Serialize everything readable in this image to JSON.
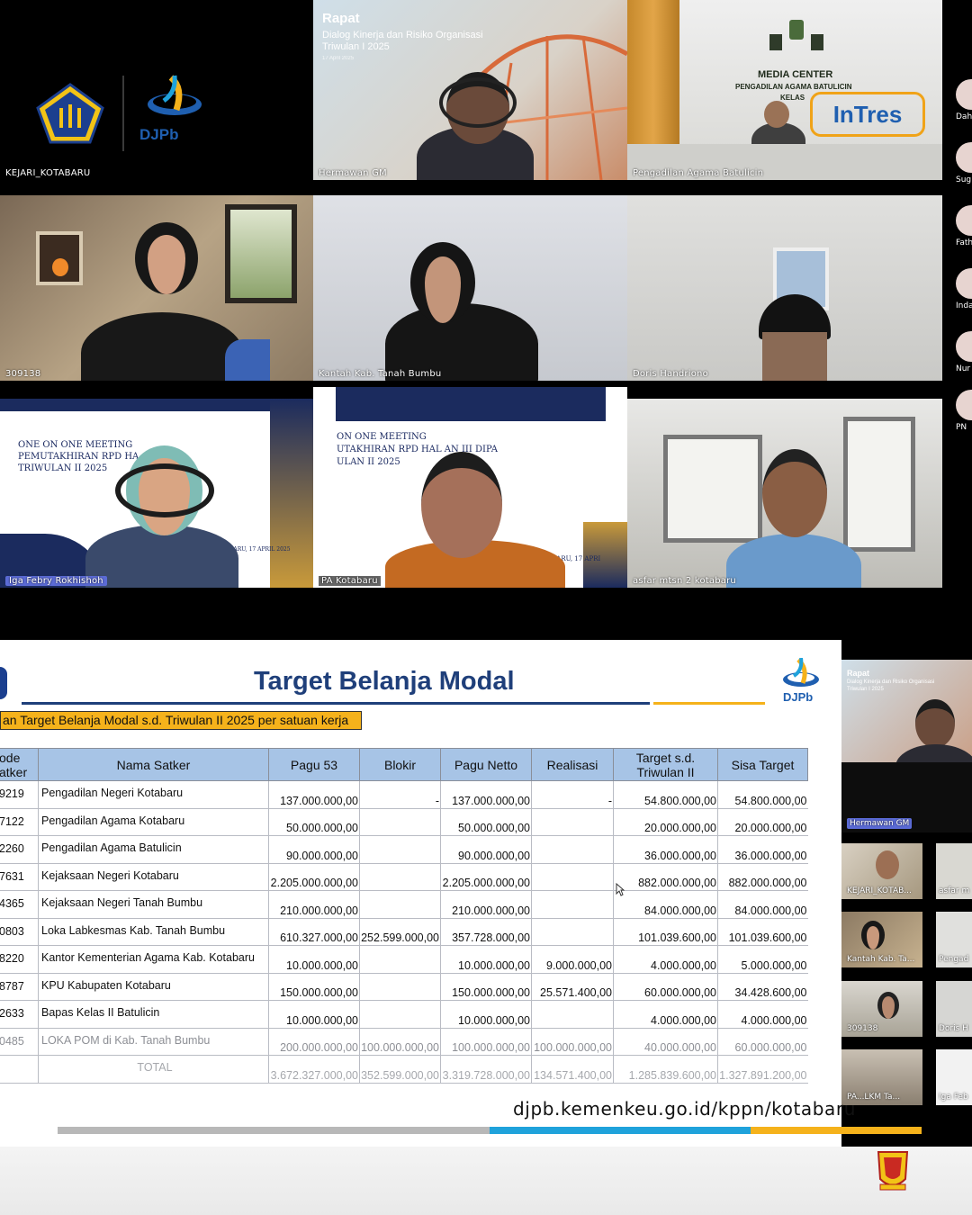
{
  "tiles": {
    "t1": "KEJARI_KOTABARU",
    "t2": "Hermawan GM",
    "t3": "Pengadilan Agama Batulicin",
    "t4": "309138",
    "t5": "Kantah Kab. Tanah Bumbu",
    "t6": "Doris Handriono",
    "t7": "Iga Febry Rokhishoh",
    "t8": "PA Kotabaru",
    "t9": "asfar mtsn 2 kotabaru"
  },
  "logo": {
    "djpb": "DJPb"
  },
  "tile2_slide": {
    "title": "Rapat",
    "line1": "Dialog Kinerja dan Risiko Organisasi",
    "line2": "Triwulan I 2025",
    "date": "17 April 2025"
  },
  "tile3_signs": {
    "media": "MEDIA CENTER",
    "court": "PENGADILAN AGAMA BATULICIN",
    "kelas": "KELAS",
    "brand": "InTres"
  },
  "tile7_slide": {
    "l1": "ONE ON ONE MEETING",
    "l2": "PEMUTAKHIRAN RPD HA",
    "l3": "TRIWULAN II 2025",
    "date": "BARU, 17 APRIL 2025"
  },
  "tile8_slide": {
    "l1": "ON ONE MEETING",
    "l2": "UTAKHIRAN RPD HAL   AN III DIPA",
    "l3": "ULAN II 2025",
    "date": "KOTABARU, 17 APRI"
  },
  "side_strip": [
    "Dah",
    "Sug",
    "Fath",
    "Inda",
    "Nur",
    "PN"
  ],
  "slide": {
    "title": "Target Belanja Modal",
    "logo": "DJPb",
    "subtitle": "an Target Belanja Modal s.d. Triwulan II 2025 per satuan kerja",
    "headers": [
      "ode\natker",
      "Nama Satker",
      "Pagu 53",
      "Blokir",
      "Pagu Netto",
      "Realisasi",
      "Target s.d.\nTriwulan II",
      "Sisa Target"
    ],
    "rows": [
      [
        "9219",
        "Pengadilan Negeri Kotabaru",
        "137.000.000,00",
        "-",
        "137.000.000,00",
        "-",
        "54.800.000,00",
        "54.800.000,00"
      ],
      [
        "7122",
        "Pengadilan Agama Kotabaru",
        "50.000.000,00",
        "",
        "50.000.000,00",
        "",
        "20.000.000,00",
        "20.000.000,00"
      ],
      [
        "2260",
        "Pengadilan Agama Batulicin",
        "90.000.000,00",
        "",
        "90.000.000,00",
        "",
        "36.000.000,00",
        "36.000.000,00"
      ],
      [
        "7631",
        "Kejaksaan Negeri Kotabaru",
        "2.205.000.000,00",
        "",
        "2.205.000.000,00",
        "",
        "882.000.000,00",
        "882.000.000,00"
      ],
      [
        "4365",
        "Kejaksaan Negeri Tanah Bumbu",
        "210.000.000,00",
        "",
        "210.000.000,00",
        "",
        "84.000.000,00",
        "84.000.000,00"
      ],
      [
        "0803",
        "Loka Labkesmas Kab. Tanah Bumbu",
        "610.327.000,00",
        "252.599.000,00",
        "357.728.000,00",
        "",
        "101.039.600,00",
        "101.039.600,00"
      ],
      [
        "8220",
        "Kantor Kementerian Agama Kab. Kotabaru",
        "10.000.000,00",
        "",
        "10.000.000,00",
        "9.000.000,00",
        "4.000.000,00",
        "5.000.000,00"
      ],
      [
        "8787",
        "KPU Kabupaten Kotabaru",
        "150.000.000,00",
        "",
        "150.000.000,00",
        "25.571.400,00",
        "60.000.000,00",
        "34.428.600,00"
      ],
      [
        "2633",
        "Bapas Kelas II Batulicin",
        "10.000.000,00",
        "",
        "10.000.000,00",
        "",
        "4.000.000,00",
        "4.000.000,00"
      ],
      [
        "0485",
        "LOKA POM di Kab. Tanah Bumbu",
        "200.000.000,00",
        "100.000.000,00",
        "100.000.000,00",
        "100.000.000,00",
        "40.000.000,00",
        "60.000.000,00"
      ]
    ],
    "total": [
      "",
      "TOTAL",
      "3.672.327.000,00",
      "352.599.000,00",
      "3.319.728.000,00",
      "134.571.400,00",
      "1.285.839.600,00",
      "1.327.891.200,00"
    ],
    "url": "djpb.kemenkeu.go.id/kppn/kotabaru"
  },
  "right_gallery": {
    "slide_title": "Rapat",
    "slide_line": "Dialog Kinerja dan Risiko Organisasi",
    "slide_line2": "Triwulan I 2025",
    "speaker": "Hermawan GM",
    "g1": "KEJARI_KOTAB...",
    "g2": "asfar m",
    "g3": "Kantah Kab. Ta...",
    "g4": "Pengad",
    "g5": "309138",
    "g6": "Doris H",
    "g7": "PA...LKM Ta...",
    "g8": "Iga Feb"
  }
}
